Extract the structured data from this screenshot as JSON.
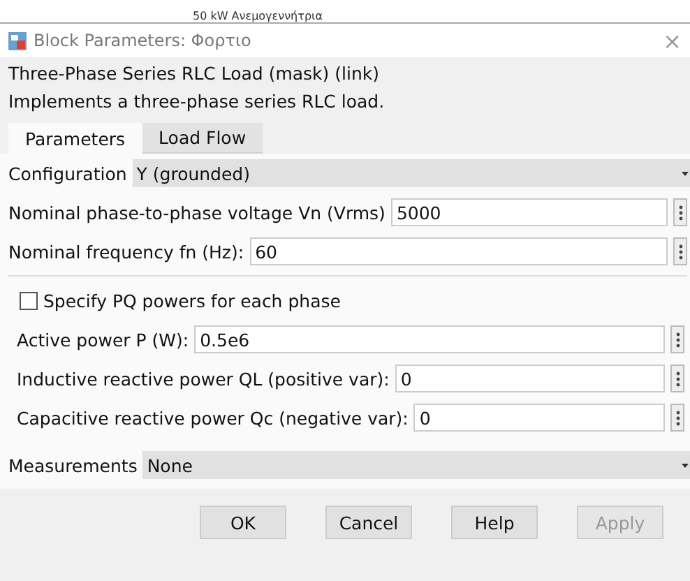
{
  "background_caption": "50 kW Ανεμογεννήτρια",
  "window": {
    "title": "Block Parameters: Φορτιο",
    "close": "×"
  },
  "description": {
    "heading": "Three-Phase Series RLC Load (mask) (link)",
    "text": "Implements a three-phase series RLC load."
  },
  "tabs": [
    {
      "label": "Parameters",
      "selected": true
    },
    {
      "label": "Load Flow",
      "selected": false
    }
  ],
  "parameters": [
    {
      "kind": "dropdown",
      "label": "Configuration",
      "value": "Y (grounded)"
    },
    {
      "kind": "field",
      "label": "Nominal phase-to-phase voltage Vn (Vrms)",
      "value": "5000"
    },
    {
      "kind": "field",
      "label": "Nominal frequency fn (Hz):",
      "value": "60"
    }
  ],
  "pq_group": [
    {
      "kind": "checkbox",
      "label": "Specify PQ powers for each phase",
      "checked": false
    },
    {
      "kind": "field",
      "label": "Active power P (W):",
      "value": "0.5e6"
    },
    {
      "kind": "field",
      "label": "Inductive reactive power QL (positive var):",
      "value": "0"
    },
    {
      "kind": "field",
      "label": "Capacitive reactive power Qc (negative var):",
      "value": "0"
    }
  ],
  "measurements": [
    {
      "kind": "dropdown",
      "label": "Measurements",
      "value": "None"
    }
  ],
  "buttons": [
    {
      "label": "OK",
      "disabled": false
    },
    {
      "label": "Cancel",
      "disabled": false
    },
    {
      "label": "Help",
      "disabled": false
    },
    {
      "label": "Apply",
      "disabled": true
    }
  ]
}
